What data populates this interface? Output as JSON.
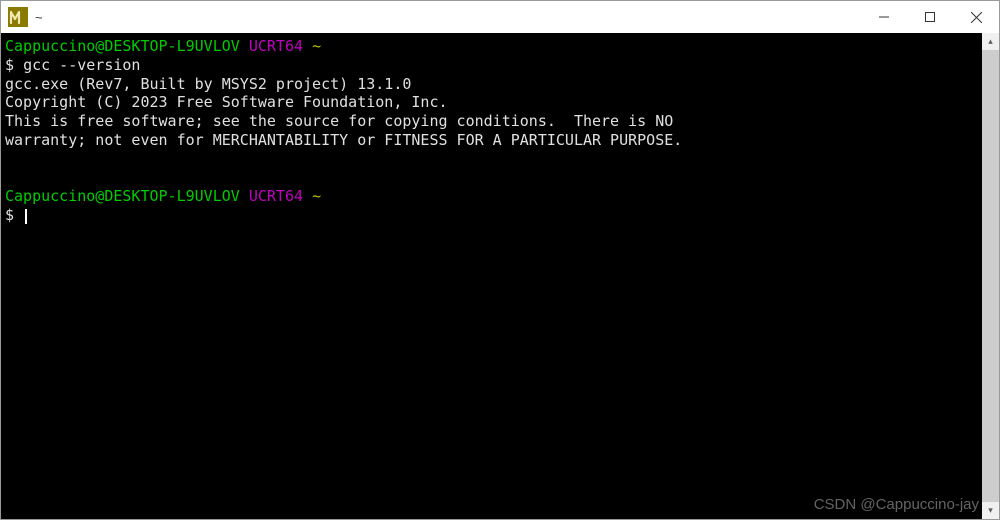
{
  "titlebar": {
    "title": "~"
  },
  "prompt1": {
    "userhost": "Cappuccino@DESKTOP-L9UVLOV",
    "env": "UCRT64",
    "dir": "~",
    "symbol": "$",
    "command": "gcc --version"
  },
  "output": {
    "line1": "gcc.exe (Rev7, Built by MSYS2 project) 13.1.0",
    "line2": "Copyright (C) 2023 Free Software Foundation, Inc.",
    "line3": "This is free software; see the source for copying conditions.  There is NO",
    "line4": "warranty; not even for MERCHANTABILITY or FITNESS FOR A PARTICULAR PURPOSE."
  },
  "prompt2": {
    "userhost": "Cappuccino@DESKTOP-L9UVLOV",
    "env": "UCRT64",
    "dir": "~",
    "symbol": "$"
  },
  "watermark": "CSDN @Cappuccino-jay"
}
